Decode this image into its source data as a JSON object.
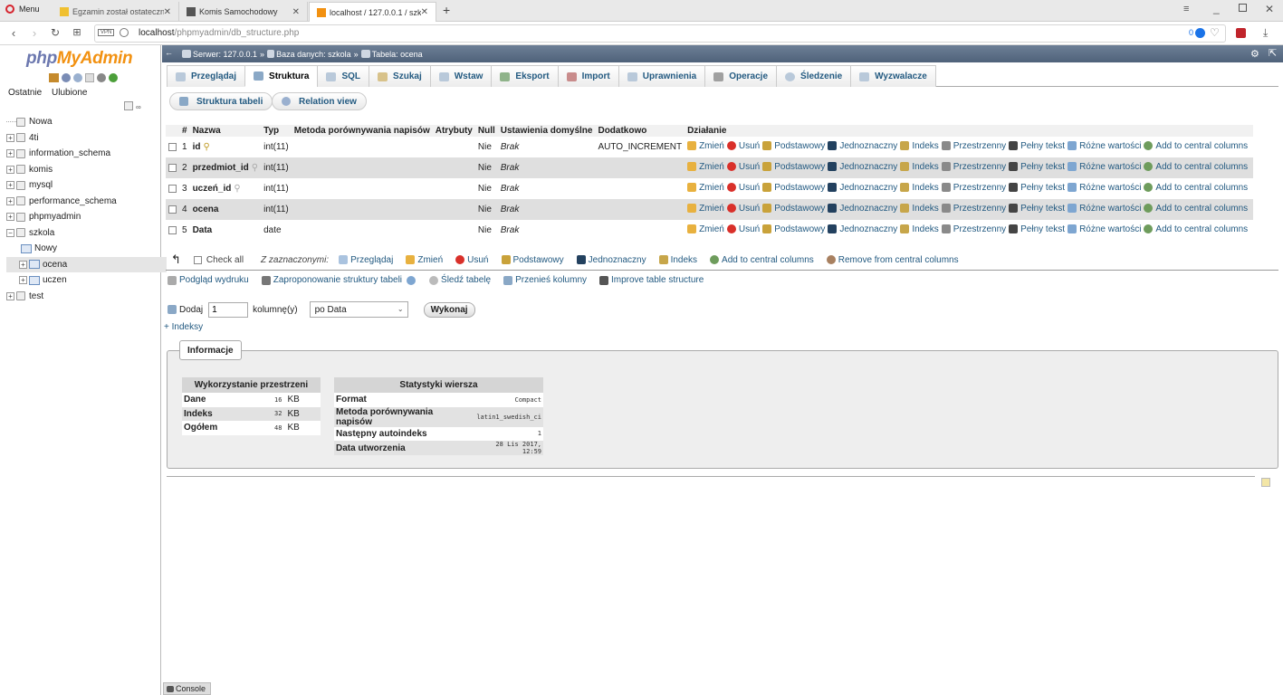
{
  "browser": {
    "menu_label": "Menu",
    "tabs": [
      {
        "title": "Egzamin został ostateczni"
      },
      {
        "title": "Komis Samochodowy"
      },
      {
        "title": "localhost / 127.0.0.1 / szk"
      }
    ],
    "url_host": "localhost",
    "url_path": "/phpmyadmin/db_structure.php",
    "vpn_label": "VPN",
    "adblock_count": "0"
  },
  "left": {
    "logo_php": "php",
    "logo_myadmin": "MyAdmin",
    "recent_label": "Ostatnie",
    "favorites_label": "Ulubione",
    "new_label": "Nowa",
    "databases": [
      "4ti",
      "information_schema",
      "komis",
      "mysql",
      "performance_schema",
      "phpmyadmin",
      "szkola",
      "test"
    ],
    "szkola_children": [
      "Nowy",
      "ocena",
      "uczen"
    ]
  },
  "breadcrumb": {
    "server": "Serwer: 127.0.0.1",
    "db": "Baza danych: szkola",
    "table": "Tabela: ocena",
    "sep": "»"
  },
  "tabs": [
    "Przeglądaj",
    "Struktura",
    "SQL",
    "Szukaj",
    "Wstaw",
    "Eksport",
    "Import",
    "Uprawnienia",
    "Operacje",
    "Śledzenie",
    "Wyzwalacze"
  ],
  "subtabs": {
    "structure": "Struktura tabeli",
    "relation": "Relation view"
  },
  "table": {
    "headers": [
      "#",
      "Nazwa",
      "Typ",
      "Metoda porównywania napisów",
      "Atrybuty",
      "Null",
      "Ustawienia domyślne",
      "Dodatkowo",
      "Działanie"
    ],
    "rows": [
      {
        "n": "1",
        "name": "id",
        "type": "int(11)",
        "null": "Nie",
        "default": "Brak",
        "extra": "AUTO_INCREMENT"
      },
      {
        "n": "2",
        "name": "przedmiot_id",
        "type": "int(11)",
        "null": "Nie",
        "default": "Brak",
        "extra": ""
      },
      {
        "n": "3",
        "name": "uczeń_id",
        "type": "int(11)",
        "null": "Nie",
        "default": "Brak",
        "extra": ""
      },
      {
        "n": "4",
        "name": "ocena",
        "type": "int(11)",
        "null": "Nie",
        "default": "Brak",
        "extra": ""
      },
      {
        "n": "5",
        "name": "Data",
        "type": "date",
        "null": "Nie",
        "default": "Brak",
        "extra": ""
      }
    ],
    "actions": [
      "Zmień",
      "Usuń",
      "Podstawowy",
      "Jednoznaczny",
      "Indeks",
      "Przestrzenny",
      "Pełny tekst",
      "Różne wartości",
      "Add to central columns"
    ]
  },
  "bulk": {
    "check_all": "Check all",
    "with_selected": "Z zaznaczonymi:",
    "actions": [
      "Przeglądaj",
      "Zmień",
      "Usuń",
      "Podstawowy",
      "Jednoznaczny",
      "Indeks",
      "Add to central columns",
      "Remove from central columns"
    ]
  },
  "tools": [
    "Podgląd wydruku",
    "Zaproponowanie struktury tabeli",
    "Śledź tabelę",
    "Przenieś kolumny",
    "Improve table structure"
  ],
  "add": {
    "label": "Dodaj",
    "count": "1",
    "unit": "kolumnę(y)",
    "position": "po Data",
    "go": "Wykonaj",
    "indexes": "+ Indeksy"
  },
  "info": {
    "legend": "Informacje",
    "space_title": "Wykorzystanie przestrzeni",
    "space_rows": [
      {
        "label": "Dane",
        "value": "16",
        "unit": "KB"
      },
      {
        "label": "Indeks",
        "value": "32",
        "unit": "KB"
      },
      {
        "label": "Ogółem",
        "value": "48",
        "unit": "KB"
      }
    ],
    "stats_title": "Statystyki wiersza",
    "stats_rows": [
      {
        "label": "Format",
        "value": "Compact"
      },
      {
        "label": "Metoda porównywania napisów",
        "value": "latin1_swedish_ci"
      },
      {
        "label": "Następny autoindeks",
        "value": "1"
      },
      {
        "label": "Data utworzenia",
        "value": "28 Lis 2017, 12:59"
      }
    ]
  },
  "console_label": "Console"
}
